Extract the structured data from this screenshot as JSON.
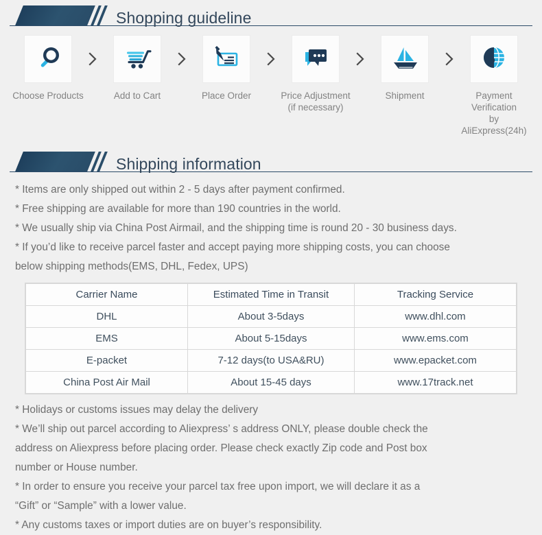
{
  "sections": {
    "guideline": {
      "title": "Shopping guideline"
    },
    "shipping": {
      "title": "Shipping information"
    }
  },
  "steps": [
    {
      "label": "Choose Products",
      "icon": "magnifier-icon"
    },
    {
      "label": "Add to Cart",
      "icon": "shopping-cart-icon"
    },
    {
      "label": "Place Order",
      "icon": "pen-check-icon"
    },
    {
      "label": "Price Adjustment\n(if necessary)",
      "icon": "chat-bubbles-icon"
    },
    {
      "label": "Shipment",
      "icon": "sailboat-icon"
    },
    {
      "label": "Payment Verification\nby AliExpress(24h)",
      "icon": "dollar-globe-icon"
    }
  ],
  "step_separator_icon": "chevron-right-icon",
  "shipping_notes_top": [
    "* Items are only shipped out within 2 - 5 days after payment confirmed.",
    "* Free shipping are available for more than 190 countries in the world.",
    "* We usually ship via China Post Airmail, and the shipping time is round 20 - 30 business days.",
    "* If you’d like to receive parcel faster and accept paying more shipping costs, you can choose\n   below shipping methods(EMS, DHL, Fedex, UPS)"
  ],
  "table": {
    "headers": [
      "Carrier  Name",
      "Estimated  Time  in  Transit",
      "Tracking  Service"
    ],
    "rows": [
      [
        "DHL",
        "About 3-5days",
        "www.dhl.com"
      ],
      [
        "EMS",
        "About 5-15days",
        "www.ems.com"
      ],
      [
        "E-packet",
        "7-12 days(to USA&RU)",
        "www.epacket.com"
      ],
      [
        "China Post Air Mail",
        "About 15-45 days",
        "www.17track.net"
      ]
    ]
  },
  "shipping_notes_bottom": [
    "* Holidays or customs issues may delay the delivery",
    "* We’ll ship out parcel according to Aliexpress’ s address ONLY, please double check the\n   address on Aliexpress before placing order. Please check exactly Zip code and Post box\n   number or House number.",
    "* In order to ensure you receive your parcel tax free upon import, we will declare it as a\n    “Gift” or  “Sample” with a lower value.",
    "* Any customs taxes or import duties are on buyer’s responsibility."
  ],
  "colors": {
    "background": "#f0f0f0",
    "banner_navy": "#2a4d69",
    "title_text": "#33475b",
    "body_text": "#6e6e6e",
    "icon_navy": "#1f3a56",
    "icon_cyan": "#2bb3e3",
    "table_border": "#d8d8d8"
  }
}
